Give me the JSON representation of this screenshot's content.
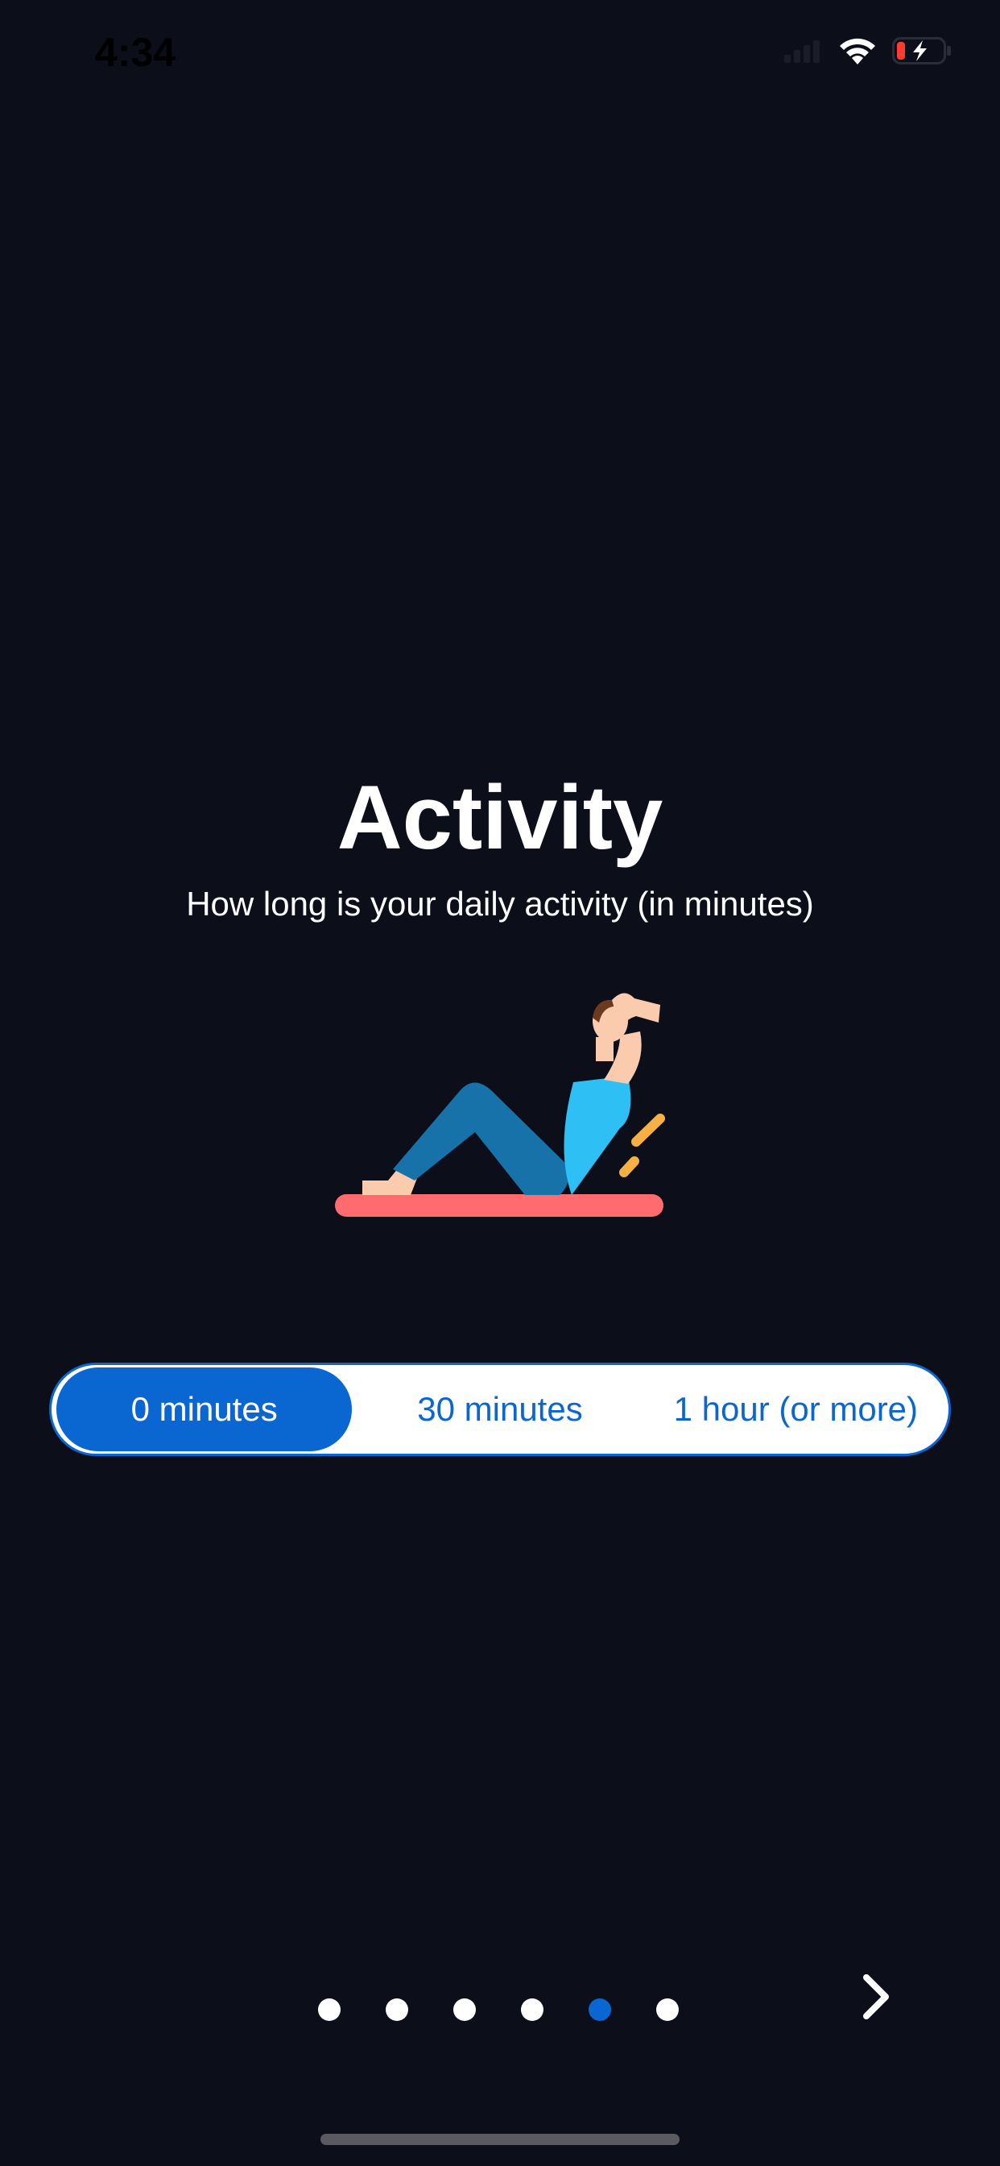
{
  "status_bar": {
    "time": "4:34"
  },
  "screen": {
    "title": "Activity",
    "subtitle": "How long is your daily activity (in minutes)"
  },
  "illustration": {
    "icon": "person-doing-situps-illustration"
  },
  "activity_options": {
    "selected_index": 0,
    "options": [
      "0 minutes",
      "30 minutes",
      "1 hour (or more)"
    ]
  },
  "pagination": {
    "total_pages": 6,
    "current_page": 5
  },
  "colors": {
    "background": "#0c0f1a",
    "accent": "#0a66d1",
    "mat": "#ff6b6f",
    "pants": "#1672a8",
    "shirt": "#2ebff4",
    "skin": "#fbcbae",
    "hair": "#6b3a1f",
    "motion_lines": "#f6b142"
  }
}
